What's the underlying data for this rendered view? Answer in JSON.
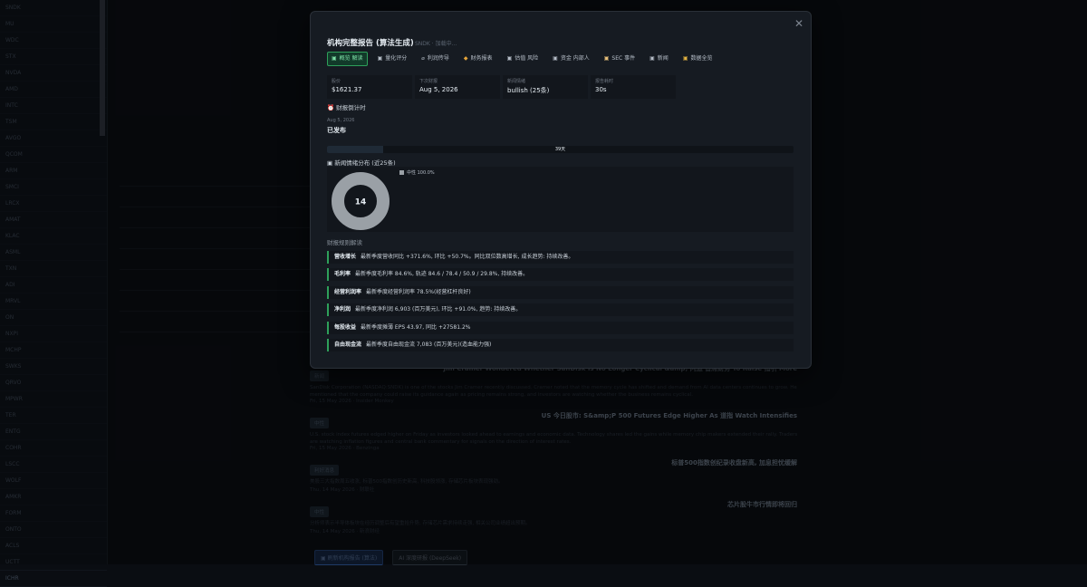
{
  "modal": {
    "title": "机构完整报告 (算法生成)",
    "subtitle": "SNDK · 加载中...",
    "close_glyph": "✕",
    "tabs": [
      {
        "icon": "▣",
        "label": "概览 解读"
      },
      {
        "icon": "▣",
        "label": "量化评分"
      },
      {
        "icon": "⌀",
        "label": "利润传导"
      },
      {
        "icon": "◆",
        "label": "财务报表"
      },
      {
        "icon": "▣",
        "label": "估值 风险"
      },
      {
        "icon": "▣",
        "label": "资金 内部人"
      },
      {
        "icon": "▣",
        "label": "SEC 事件"
      },
      {
        "icon": "▣",
        "label": "新闻"
      },
      {
        "icon": "▣",
        "label": "数据全览"
      }
    ],
    "stats": [
      {
        "label": "股价",
        "value": "$1621.37"
      },
      {
        "label": "下次财报",
        "value": "Aug 5, 2026"
      },
      {
        "label": "新闻情绪",
        "value": "bullish (25条)"
      },
      {
        "label": "报告耗时",
        "value": "30s"
      }
    ],
    "earnings_section": {
      "icon": "⏰",
      "title": "财报倒计时",
      "date": "Aug 5, 2026",
      "status": "已发布"
    },
    "countdown": {
      "label": "39天",
      "progress": 0.12
    },
    "sentiment": {
      "icon": "▣",
      "title": "新闻情绪分布 (近25条)",
      "center_value": "14",
      "legend": [
        {
          "name": "中性",
          "pct": "100.0%",
          "color": "#9aa0a6"
        }
      ],
      "share": 1.0
    },
    "interp_title": "财报规则解读",
    "interp": [
      {
        "key": "营收增长",
        "text": "最新季度营收同比 +371.6%, 环比 +50.7%。同比双位数高增长, 成长趋势: 持续改善。"
      },
      {
        "key": "毛利率",
        "text": "最新季度毛利率 84.6%, 轨迹 84.6 / 78.4 / 50.9 / 29.8%, 持续改善。"
      },
      {
        "key": "经营利润率",
        "text": "最新季度经营利润率 78.5%(经营杠杆良好)"
      },
      {
        "key": "净利润",
        "text": "最新季度净利润 6,903 (百万美元), 环比 +91.0%, 趋势: 持续改善。"
      },
      {
        "key": "每股收益",
        "text": "最新季度摊薄 EPS 43.97, 同比 +27581.2%"
      },
      {
        "key": "自由现金流",
        "text": "最新季度自由现金流 7,083 (百万美元)(造血能力强)"
      }
    ]
  },
  "background": {
    "left_rows": [
      "SNDK",
      "MU",
      "WDC",
      "STX",
      "NVDA",
      "AMD",
      "INTC",
      "TSM",
      "AVGO",
      "QCOM",
      "ARM",
      "SMCI",
      "LRCX",
      "AMAT",
      "KLAC",
      "ASML",
      "TXN",
      "ADI",
      "MRVL",
      "ON",
      "NXPI",
      "MCHP",
      "SWKS",
      "QRVO",
      "MPWR",
      "TER",
      "ENTG",
      "COHR",
      "LSCC",
      "WOLF",
      "AMKR",
      "FORM",
      "ONTO",
      "ACLS",
      "UCTT",
      "ICHR"
    ],
    "news": [
      {
        "tag": "新闻",
        "title": "Jim Cramer Wondered Whether SanDisk Is No Longer Cyclical &amp; 闪迪 首席财务 To Raise 指引 More",
        "body": "SanDisk Corporation (NASDAQ:SNDK) is one of the stocks Jim Cramer recently discussed. Cramer noted that the memory cycle has shifted and demand from AI data centers continues to grow. He mentioned that the company could raise its guidance again as pricing remains strong, and investors are watching whether the business remains cyclical.",
        "meta": "Fri, 15 May 2026 · Insider Monkey"
      },
      {
        "tag": "中性",
        "title": "US 今日股市: S&amp;P 500 Futures Edge Higher As 道指 Watch Intensifies",
        "body": "U.S. stock index futures edged higher on Friday as investors looked ahead to earnings and economic data. Technology shares led the gains while memory chip makers extended their rally. Traders are watching inflation figures and central bank commentary for signals on the direction of interest rates.",
        "meta": "Fri, 15 May 2026 · Benzinga"
      },
      {
        "tag": "利好消息",
        "title": "标普500指数创纪录收盘新高, 加息担忧缓解",
        "body": "美股三大指数周五收涨, 标普500指数创历史新高, 科技股领涨, 存储芯片板块表现强劲。",
        "meta": "Thu, 14 May 2026 · 财联社"
      },
      {
        "tag": "中性",
        "title": "芯片股牛市行情即将回归",
        "body": "分析师表示半导体板块在经历调整后有望重拾升势, 存储芯片需求持续走强, 相关公司业绩超出预期。",
        "meta": "Thu, 14 May 2026 · 新浪财经"
      }
    ],
    "buttons": [
      "▣ 刷新机构报告 (算法)",
      "AI 深度研报 (DeepSeek)"
    ]
  }
}
